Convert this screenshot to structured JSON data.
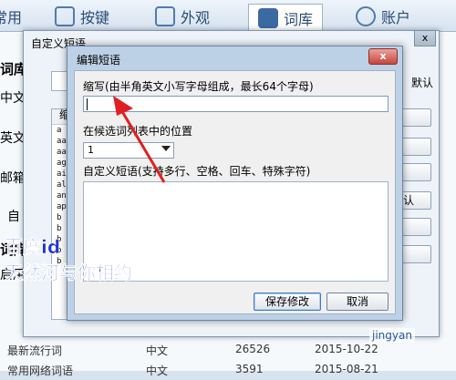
{
  "settings": {
    "tabs": [
      {
        "label": "常用"
      },
      {
        "label": "按键"
      },
      {
        "label": "外观"
      },
      {
        "label": "词库"
      },
      {
        "label": "账户"
      }
    ],
    "left_labels": [
      "词库",
      "中文",
      "英文",
      "邮箱",
      "自",
      "词库",
      "启用"
    ],
    "right_buttons": [
      "",
      "",
      "",
      "认",
      "",
      ""
    ],
    "table_rows": [
      {
        "name": "最新流行词",
        "lang": "中文",
        "count": "26526",
        "date": "2015-10-22"
      },
      {
        "name": "常用网络词语",
        "lang": "中文",
        "count": "3591",
        "date": "2015-08-21"
      }
    ]
  },
  "custom_phrase_dialog": {
    "title": "自定义短语",
    "close_label": "x",
    "default_label": "默认",
    "list_header": "缩",
    "list_rows": [
      "a",
      "aa",
      "aa",
      "ag",
      "ai",
      "al",
      "an",
      "ap",
      "b",
      "b",
      "b",
      "b",
      "b"
    ]
  },
  "edit_phrase_dialog": {
    "title": "编辑短语",
    "close_label": "x",
    "abbr_label": "缩写(由半角英文小写字母组成，最长64个字母)",
    "abbr_value": "",
    "position_label": "在候选词列表中的位置",
    "position_value": "1",
    "phrase_label": "自定义短语(支持多行、空格、回车、特殊字符)",
    "phrase_value": "",
    "save_label": "保存修改",
    "cancel_label": "取消"
  },
  "watermark": {
    "line1": "百度id",
    "line2": "天然河与你相约"
  },
  "logo_text": "jingyan"
}
